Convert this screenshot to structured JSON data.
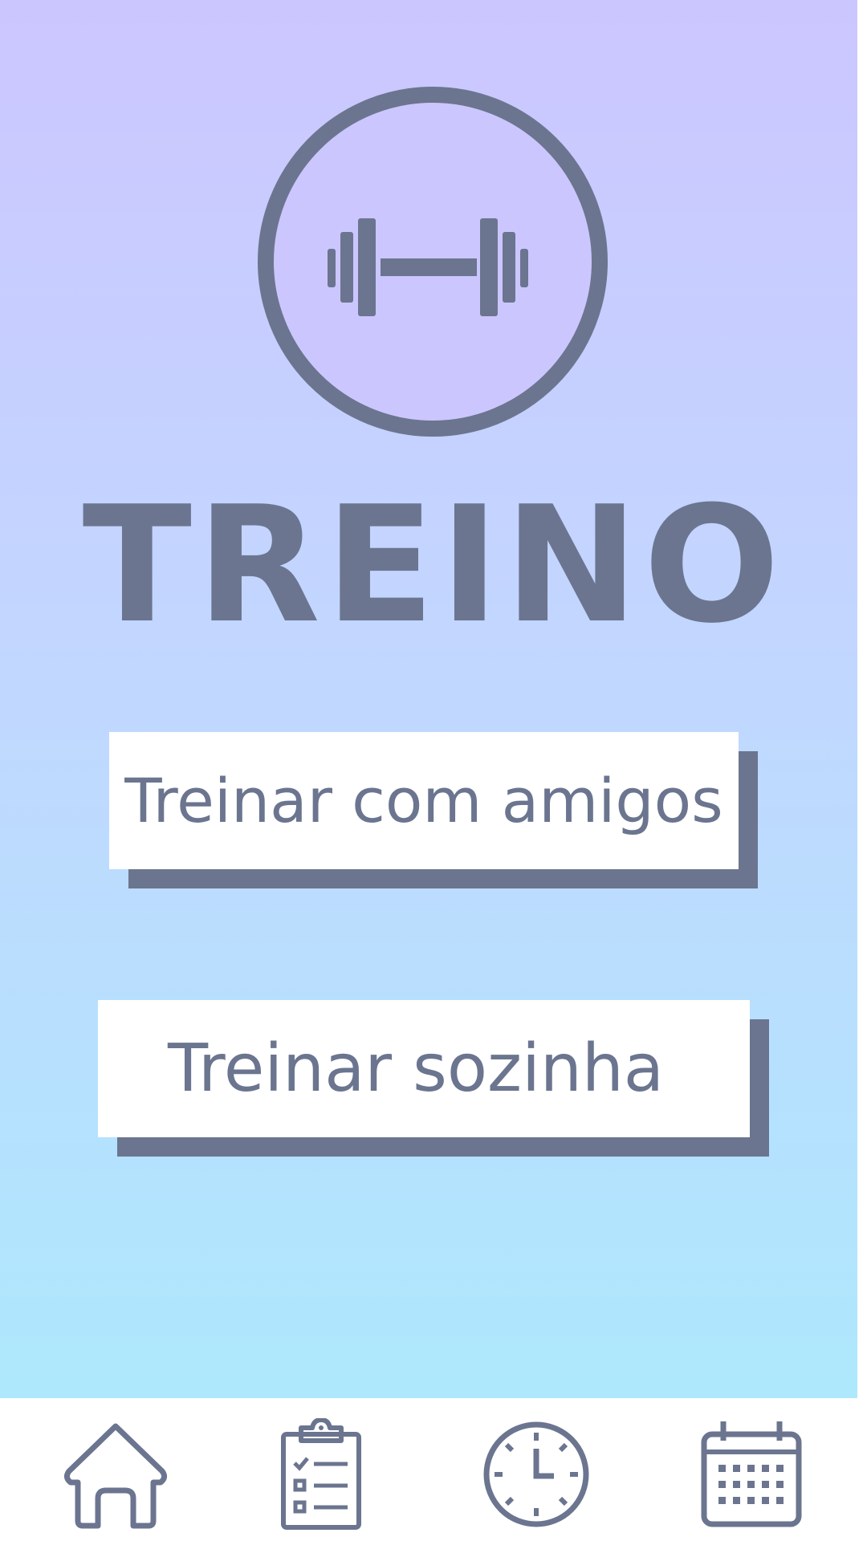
{
  "app": {
    "title": "TREINO",
    "logo_icon": "dumbbell-icon"
  },
  "actions": {
    "train_with_friends_label": "Treinar com amigos",
    "train_alone_label": "Treinar sozinha"
  },
  "bottom_nav": {
    "items": [
      {
        "icon": "home-icon"
      },
      {
        "icon": "clipboard-checklist-icon"
      },
      {
        "icon": "clock-icon"
      },
      {
        "icon": "calendar-icon"
      }
    ]
  },
  "colors": {
    "accent": "#6b758f",
    "gradient_top": "#ccc6ff",
    "gradient_bottom": "#aee8fd",
    "button_bg": "#ffffff"
  }
}
